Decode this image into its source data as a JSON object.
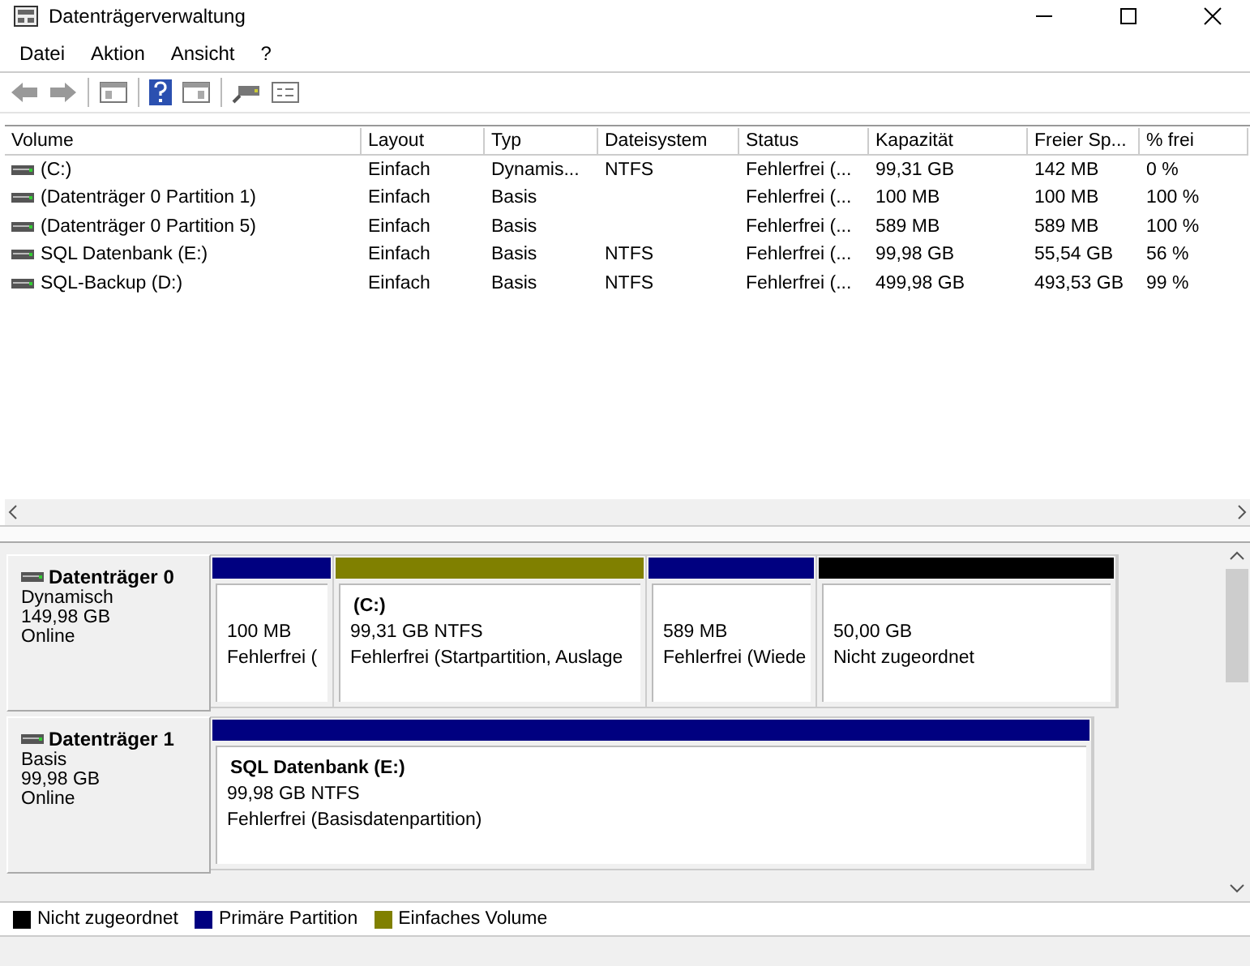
{
  "window": {
    "title": "Datenträgerverwaltung"
  },
  "menu": [
    {
      "label": "Datei"
    },
    {
      "label": "Aktion"
    },
    {
      "label": "Ansicht"
    },
    {
      "label": "?"
    }
  ],
  "table": {
    "columns": [
      "Volume",
      "Layout",
      "Typ",
      "Dateisystem",
      "Status",
      "Kapazität",
      "Freier Sp...",
      "% frei"
    ],
    "rows": [
      [
        "(C:)",
        "Einfach",
        "Dynamis...",
        "NTFS",
        "Fehlerfrei (...",
        "99,31 GB",
        "142 MB",
        "0 %"
      ],
      [
        "(Datenträger 0 Partition 1)",
        "Einfach",
        "Basis",
        null,
        "Fehlerfrei (...",
        "100 MB",
        "100 MB",
        "100 %"
      ],
      [
        "(Datenträger 0 Partition 5)",
        "Einfach",
        "Basis",
        null,
        "Fehlerfrei (...",
        "589 MB",
        "589 MB",
        "100 %"
      ],
      [
        "SQL Datenbank (E:)",
        "Einfach",
        "Basis",
        "NTFS",
        "Fehlerfrei (...",
        "99,98 GB",
        "55,54 GB",
        "56 %"
      ],
      [
        "SQL-Backup (D:)",
        "Einfach",
        "Basis",
        "NTFS",
        "Fehlerfrei (...",
        "499,98 GB",
        "493,53 GB",
        "99 %"
      ]
    ]
  },
  "disks": [
    {
      "name": "Datenträger 0",
      "type": "Dynamisch",
      "size": "149,98 GB",
      "status": "Online",
      "partitions": [
        {
          "color": "#000080",
          "lines": [
            "100 MB",
            "Fehlerfrei ("
          ]
        },
        {
          "color": "#808000",
          "title": "(C:)",
          "lines": [
            "99,31 GB NTFS",
            "Fehlerfrei (Startpartition, Auslage"
          ]
        },
        {
          "color": "#000080",
          "lines": [
            "589 MB",
            "Fehlerfrei (Wiede"
          ]
        },
        {
          "color": "#000000",
          "lines": [
            "50,00 GB",
            "Nicht zugeordnet"
          ]
        }
      ]
    },
    {
      "name": "Datenträger 1",
      "type": "Basis",
      "size": "99,98 GB",
      "status": "Online",
      "partitions": [
        {
          "color": "#000080",
          "title": "SQL Datenbank  (E:)",
          "lines": [
            "99,98 GB NTFS",
            "Fehlerfrei (Basisdatenpartition)"
          ]
        }
      ]
    }
  ],
  "legend": [
    {
      "label": "Nicht zugeordnet",
      "color": "#000000"
    },
    {
      "label": "Primäre Partition",
      "color": "#000080"
    },
    {
      "label": "Einfaches Volume",
      "color": "#808000"
    }
  ]
}
